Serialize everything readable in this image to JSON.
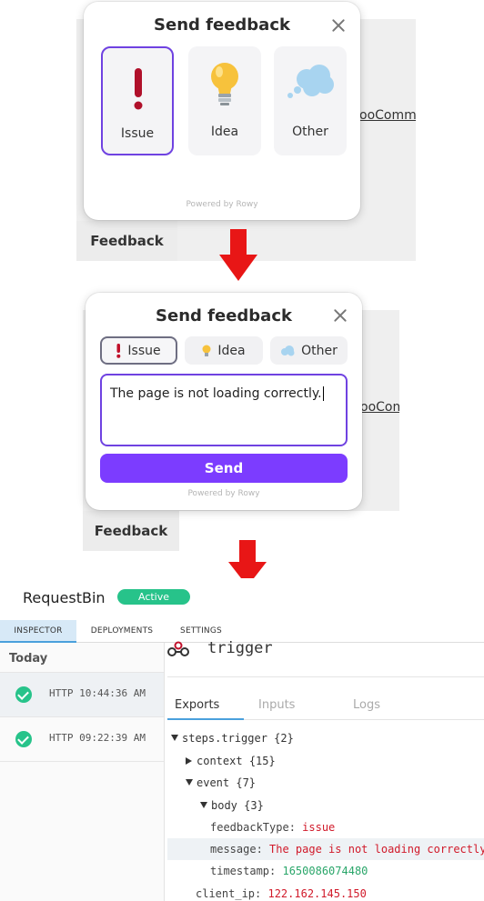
{
  "popup": {
    "title": "Send feedback",
    "powered_by": "Powered by Rowy",
    "options": [
      {
        "label": "Issue",
        "icon": "exclamation-icon"
      },
      {
        "label": "Idea",
        "icon": "lightbulb-icon"
      },
      {
        "label": "Other",
        "icon": "cloud-icon"
      }
    ],
    "message_value": "The page is not loading correctly.",
    "send_label": "Send"
  },
  "background": {
    "link_text_1": "ooComme",
    "link_text_2": "ooCom",
    "feedback_label": "Feedback"
  },
  "colors": {
    "accent_purple": "#7c3cff",
    "arrow_red": "#e81616",
    "status_green": "#27c38a"
  },
  "requestbin": {
    "title": "RequestBin",
    "status": "Active",
    "tabs": [
      "INSPECTOR",
      "DEPLOYMENTS",
      "SETTINGS"
    ],
    "group_label": "Today",
    "events": [
      {
        "text": "HTTP 10:44:36 AM"
      },
      {
        "text": "HTTP 09:22:39 AM"
      }
    ],
    "step_title": "trigger",
    "sub_tabs": [
      "Exports",
      "Inputs",
      "Logs"
    ],
    "tree": {
      "root": "steps.trigger",
      "root_count": "{2}",
      "context": "context",
      "context_count": "{15}",
      "event": "event",
      "event_count": "{7}",
      "body": "body",
      "body_count": "{3}",
      "feedbackType_key": "feedbackType:",
      "feedbackType_val": "issue",
      "message_key": "message:",
      "message_val": "The page is not loading correctly.",
      "timestamp_key": "timestamp:",
      "timestamp_val": "1650086074480",
      "client_ip_key": "client_ip:",
      "client_ip_val": "122.162.145.150"
    }
  }
}
